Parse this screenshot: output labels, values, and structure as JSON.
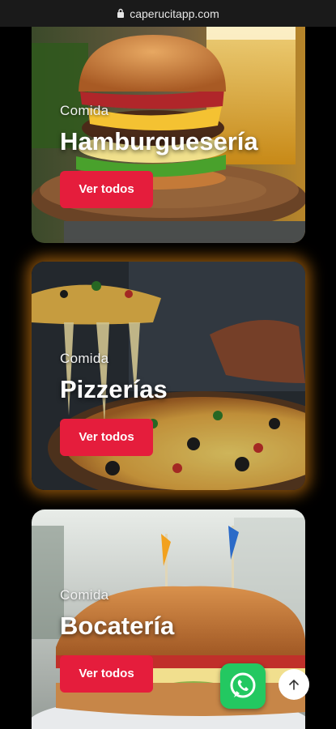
{
  "browser": {
    "url": "caperucitapp.com"
  },
  "cards": [
    {
      "kicker": "Comida",
      "title": "Hamburguesería",
      "button": "Ver todos"
    },
    {
      "kicker": "Comida",
      "title": "Pizzerías",
      "button": "Ver todos"
    },
    {
      "kicker": "Comida",
      "title": "Bocatería",
      "button": "Ver todos"
    }
  ],
  "colors": {
    "button": "#e51d3c",
    "whatsapp": "#23c861",
    "highlight_glow": "#ff9614"
  },
  "floating": {
    "whatsapp_icon": "whatsapp-icon",
    "scroll_top_icon": "arrow-up-icon"
  }
}
